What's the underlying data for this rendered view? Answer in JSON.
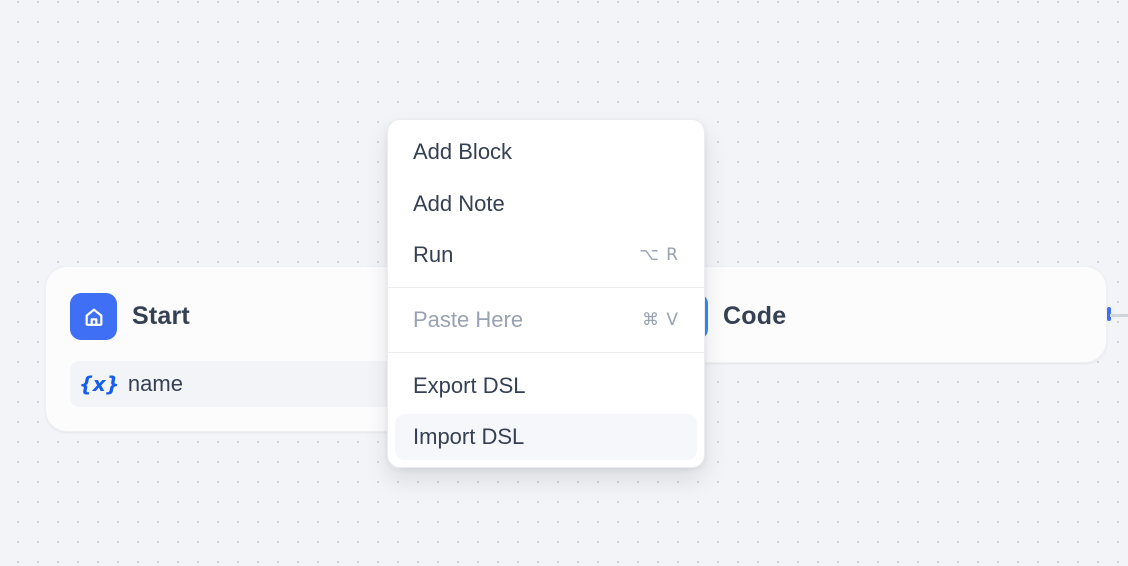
{
  "canvas": {
    "nodes": {
      "start": {
        "title": "Start",
        "icon": "home-icon",
        "icon_color": "#3e6ff5",
        "variables": [
          {
            "icon_text": "{x}",
            "name": "name"
          }
        ]
      },
      "code": {
        "title": "Code",
        "icon_color": "#2e90fa"
      }
    }
  },
  "context_menu": {
    "items": [
      {
        "label": "Add Block",
        "shortcut": ""
      },
      {
        "label": "Add Note",
        "shortcut": ""
      },
      {
        "label": "Run",
        "shortcut": "⌥ R"
      },
      {
        "label": "Paste Here",
        "shortcut": "⌘ V",
        "disabled": true
      },
      {
        "label": "Export DSL",
        "shortcut": ""
      },
      {
        "label": "Import DSL",
        "shortcut": "",
        "hovered": true
      }
    ]
  },
  "colors": {
    "accent": "#3e6ff5",
    "text": "#354052",
    "muted": "#98a2b3",
    "canvas_bg": "#f2f4f7"
  }
}
